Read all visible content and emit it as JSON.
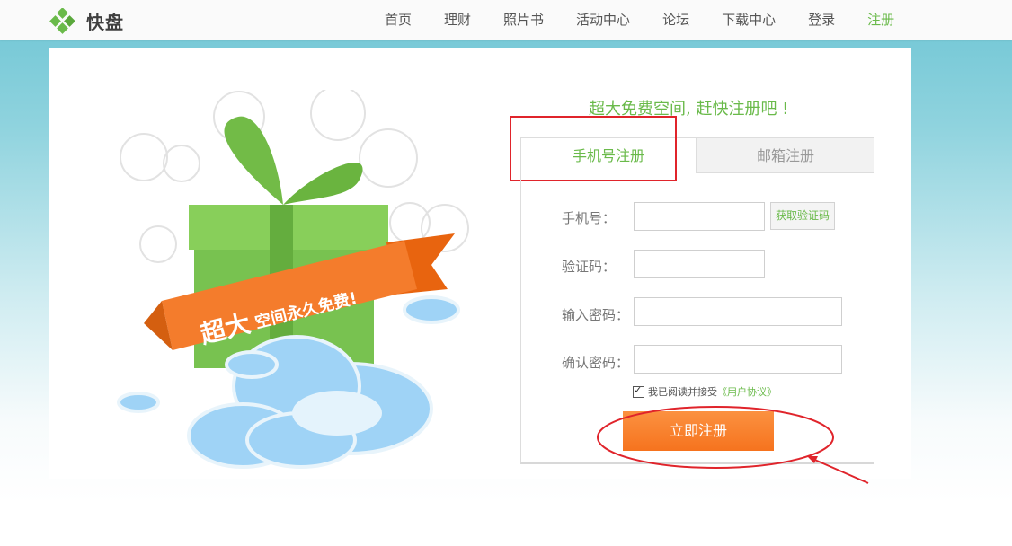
{
  "header": {
    "brand": "快盘",
    "nav": [
      {
        "label": "首页"
      },
      {
        "label": "理财"
      },
      {
        "label": "照片书"
      },
      {
        "label": "活动中心"
      },
      {
        "label": "论坛"
      },
      {
        "label": "下载中心"
      },
      {
        "label": "登录"
      },
      {
        "label": "注册"
      }
    ]
  },
  "colors": {
    "accent": "#6aba4a",
    "orange": "#f6731e",
    "highlight": "#e0242b"
  },
  "banner": {
    "ribbon_big": "超大",
    "ribbon_rest": "空间永久免费!"
  },
  "register": {
    "slogan": "超大免费空间, 赶快注册吧 !",
    "tabs": {
      "phone": "手机号注册",
      "email": "邮箱注册"
    },
    "fields": {
      "phone_label": "手机号：",
      "code_label": "验证码：",
      "password_label": "输入密码：",
      "confirm_label": "确认密码："
    },
    "get_code": "获取验证码",
    "agree_text": "我已阅读并接受",
    "agree_link": "《用户协议》",
    "submit": "立即注册"
  }
}
